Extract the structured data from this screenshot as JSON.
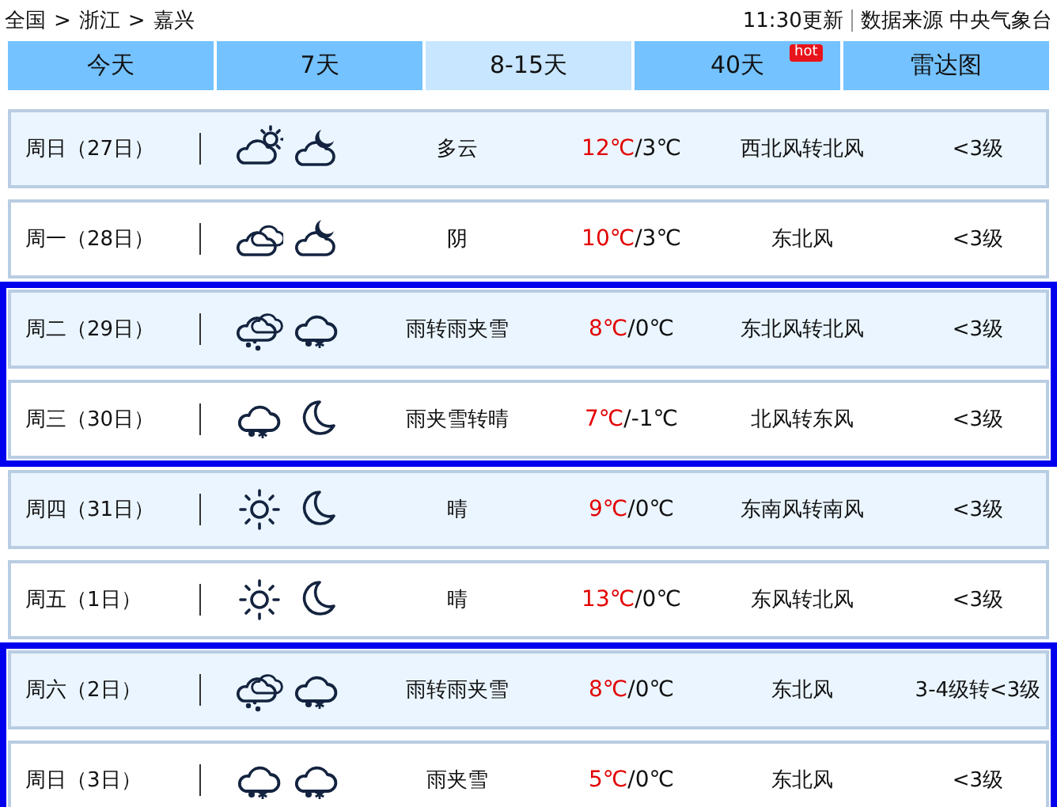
{
  "breadcrumb": [
    {
      "label": "全国"
    },
    {
      "label": "浙江"
    },
    {
      "label": "嘉兴"
    }
  ],
  "breadcrumb_separator": ">",
  "update_time": "11:30更新",
  "source": "数据来源 中央气象台",
  "tabs": [
    {
      "label": "今天",
      "selected": false
    },
    {
      "label": "7天",
      "selected": false
    },
    {
      "label": "8-15天",
      "selected": true
    },
    {
      "label": "40天",
      "selected": false,
      "badge": "hot"
    },
    {
      "label": "雷达图",
      "selected": false
    }
  ],
  "groups": [
    {
      "highlighted": false,
      "days": [
        {
          "date": "周日（27日）",
          "icons": [
            {
              "kind": "partly-cloudy-day"
            },
            {
              "kind": "partly-cloudy-night"
            }
          ],
          "weather": "多云",
          "high": "12℃",
          "low": "/3℃",
          "wind": "西北风转北风",
          "level": "<3级"
        },
        {
          "date": "周一（28日）",
          "icons": [
            {
              "kind": "overcast"
            },
            {
              "kind": "partly-cloudy-night"
            }
          ],
          "weather": "阴",
          "high": "10℃",
          "low": "/3℃",
          "wind": "东北风",
          "level": "<3级"
        }
      ]
    },
    {
      "highlighted": true,
      "days": [
        {
          "date": "周二（29日）",
          "icons": [
            {
              "kind": "rain"
            },
            {
              "kind": "sleet"
            }
          ],
          "weather": "雨转雨夹雪",
          "high": "8℃",
          "low": "/0℃",
          "wind": "东北风转北风",
          "level": "<3级"
        },
        {
          "date": "周三（30日）",
          "icons": [
            {
              "kind": "sleet"
            },
            {
              "kind": "clear-night"
            }
          ],
          "weather": "雨夹雪转晴",
          "high": "7℃",
          "low": "/-1℃",
          "wind": "北风转东风",
          "level": "<3级"
        }
      ]
    },
    {
      "highlighted": false,
      "days": [
        {
          "date": "周四（31日）",
          "icons": [
            {
              "kind": "clear-day"
            },
            {
              "kind": "clear-night"
            }
          ],
          "weather": "晴",
          "high": "9℃",
          "low": "/0℃",
          "wind": "东南风转南风",
          "level": "<3级"
        },
        {
          "date": "周五（1日）",
          "icons": [
            {
              "kind": "clear-day"
            },
            {
              "kind": "clear-night"
            }
          ],
          "weather": "晴",
          "high": "13℃",
          "low": "/0℃",
          "wind": "东风转北风",
          "level": "<3级"
        }
      ]
    },
    {
      "highlighted": true,
      "days": [
        {
          "date": "周六（2日）",
          "icons": [
            {
              "kind": "rain"
            },
            {
              "kind": "sleet"
            }
          ],
          "weather": "雨转雨夹雪",
          "high": "8℃",
          "low": "/0℃",
          "wind": "东北风",
          "level": "3-4级转<3级"
        },
        {
          "date": "周日（3日）",
          "icons": [
            {
              "kind": "sleet"
            },
            {
              "kind": "sleet"
            }
          ],
          "weather": "雨夹雪",
          "high": "5℃",
          "low": "/0℃",
          "wind": "东北风",
          "level": "<3级"
        }
      ]
    }
  ]
}
